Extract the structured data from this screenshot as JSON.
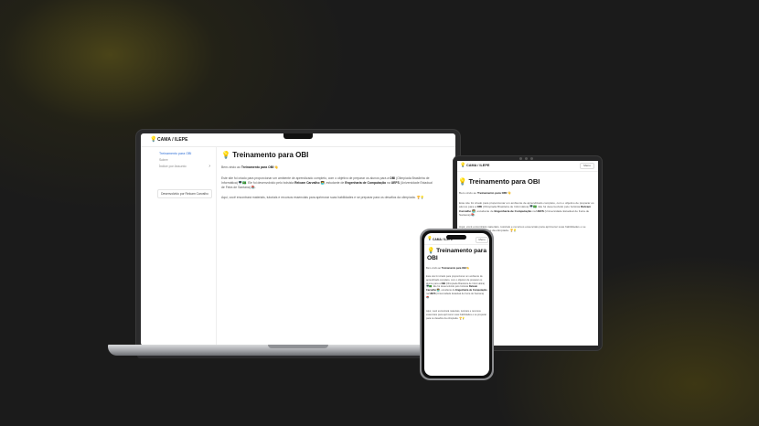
{
  "site": {
    "brand": "CAMA / ILEPE",
    "page_title": "Treinamento para OBI",
    "menu_label": "Menu"
  },
  "sidebar": {
    "items": [
      {
        "label": "Treinamento para OBI"
      },
      {
        "label": "Sobre"
      },
      {
        "label": "Índice por Assunto",
        "chevron": "›"
      }
    ],
    "footer_button": "Desenvolvido por Relcam Carvalho"
  },
  "content": {
    "intro_prefix": "Bem-vindo ao",
    "intro_bold": "Treinamento para OBI",
    "intro_emoji": "!👋",
    "p1": {
      "t1": "Este site foi criado para proporcionar um ambiente de aprendizado completo, com o objetivo de preparar os alunos para a ",
      "b1": "OBI",
      "t2": " (Olimpíada Brasileira de Informática) 🖥️🇧🇷. Ele foi desenvolvido pelo bolsista ",
      "b2": "Relcam Carvalho",
      "t3": " 🧑‍💻, estudante de ",
      "b3": "Engenharia de Computação",
      "t4": " na ",
      "b4": "UEFS",
      "t5": " (Universidade Estadual de Feira de Santana) 📚."
    },
    "p2": "Aqui, você encontrará materiais, tutoriais e recursos essenciais para aprimorar suas habilidades e se preparar para os desafios da olimpíada. 🏆💡"
  },
  "colors": {
    "background": "#1b1b1b",
    "accent_glow": "#4a4418",
    "text_dark": "#111111",
    "text_muted": "#555555",
    "link_blue": "#2f6fd6"
  },
  "icons": [
    "lightbulb-icon",
    "title-emoji-icon",
    "chevron-right-icon"
  ]
}
